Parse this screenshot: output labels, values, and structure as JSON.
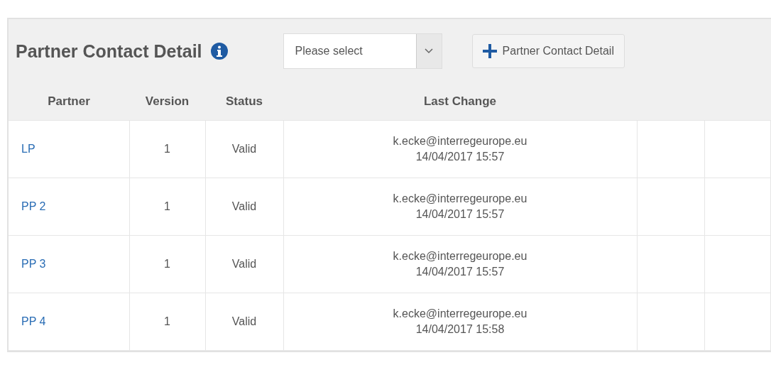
{
  "panel": {
    "title": "Partner Contact Detail",
    "select": {
      "placeholder": "Please select"
    },
    "add_button": {
      "label": "Partner Contact Detail"
    }
  },
  "table": {
    "columns": [
      "Partner",
      "Version",
      "Status",
      "Last Change"
    ],
    "rows": [
      {
        "partner": "LP",
        "version": "1",
        "status": "Valid",
        "changed_by": "k.ecke@interregeurope.eu",
        "changed_at": "14/04/2017 15:57"
      },
      {
        "partner": "PP 2",
        "version": "1",
        "status": "Valid",
        "changed_by": "k.ecke@interregeurope.eu",
        "changed_at": "14/04/2017 15:57"
      },
      {
        "partner": "PP 3",
        "version": "1",
        "status": "Valid",
        "changed_by": "k.ecke@interregeurope.eu",
        "changed_at": "14/04/2017 15:57"
      },
      {
        "partner": "PP 4",
        "version": "1",
        "status": "Valid",
        "changed_by": "k.ecke@interregeurope.eu",
        "changed_at": "14/04/2017 15:58"
      }
    ]
  }
}
